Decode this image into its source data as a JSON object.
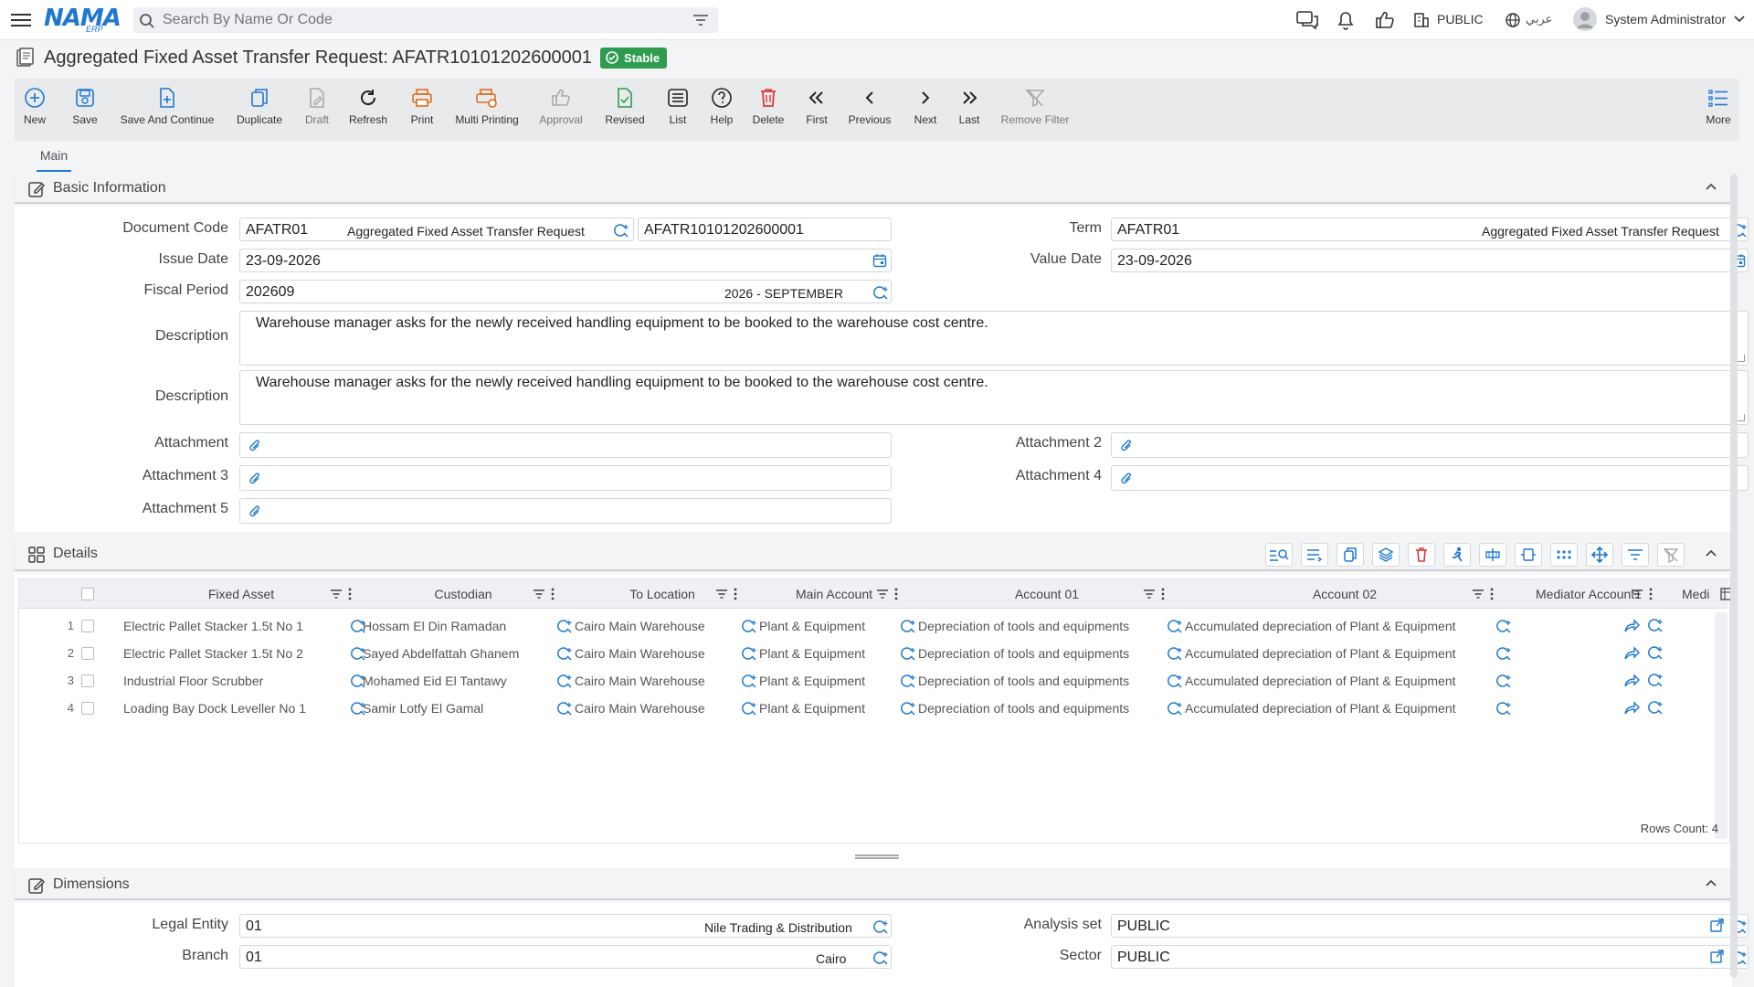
{
  "topbar": {
    "logo": "NAMA",
    "logo_sub": "ERP",
    "search_placeholder": "Search By Name Or Code",
    "entity": "PUBLIC",
    "language": "عربي",
    "user": "System Administrator"
  },
  "title": {
    "text": "Aggregated Fixed Asset Transfer Request: AFATR10101202600001",
    "status": "Stable"
  },
  "toolbar": {
    "new": "New",
    "save": "Save",
    "save_continue": "Save And Continue",
    "duplicate": "Duplicate",
    "draft": "Draft",
    "refresh": "Refresh",
    "print": "Print",
    "multi_printing": "Multi Printing",
    "approval": "Approval",
    "revised": "Revised",
    "list": "List",
    "help": "Help",
    "delete": "Delete",
    "first": "First",
    "previous": "Previous",
    "next": "Next",
    "last": "Last",
    "remove_filter": "Remove Filter",
    "more": "More"
  },
  "tabs": {
    "main": "Main"
  },
  "basic": {
    "title": "Basic Information",
    "document_code_label": "Document Code",
    "document_code": "AFATR01",
    "document_code_desc": "Aggregated Fixed Asset Transfer Request",
    "document_number": "AFATR10101202600001",
    "term_label": "Term",
    "term": "AFATR01",
    "term_desc": "Aggregated Fixed Asset Transfer Request",
    "issue_date_label": "Issue Date",
    "issue_date": "23-09-2026",
    "value_date_label": "Value Date",
    "value_date": "23-09-2026",
    "fiscal_period_label": "Fiscal Period",
    "fiscal_period": "202609",
    "fiscal_period_desc": "2026 - SEPTEMBER",
    "description_label": "Description",
    "description_1": "Warehouse manager asks for the newly received handling equipment to be booked to the warehouse cost centre.",
    "description_2": "Warehouse manager asks for the newly received handling equipment to be booked to the warehouse cost centre.",
    "attachment_1_label": "Attachment",
    "attachment_2_label": "Attachment 2",
    "attachment_3_label": "Attachment 3",
    "attachment_4_label": "Attachment 4",
    "attachment_5_label": "Attachment 5"
  },
  "details": {
    "title": "Details",
    "columns": [
      "Fixed Asset",
      "Custodian",
      "To Location",
      "Main Account",
      "Account 01",
      "Account 02",
      "Mediator Account1",
      "Medi"
    ],
    "rows": [
      {
        "num": "1",
        "fixed_asset": "Electric Pallet Stacker 1.5t No 1",
        "custodian": "Hossam El Din Ramadan",
        "to_location": "Cairo Main Warehouse",
        "main_account": "Plant & Equipment",
        "account_01": "Depreciation of tools and equipments",
        "account_02": "Accumulated depreciation of Plant & Equipment"
      },
      {
        "num": "2",
        "fixed_asset": "Electric Pallet Stacker 1.5t No 2",
        "custodian": "Sayed Abdelfattah Ghanem",
        "to_location": "Cairo Main Warehouse",
        "main_account": "Plant & Equipment",
        "account_01": "Depreciation of tools and equipments",
        "account_02": "Accumulated depreciation of Plant & Equipment"
      },
      {
        "num": "3",
        "fixed_asset": "Industrial Floor Scrubber",
        "custodian": "Mohamed Eid El Tantawy",
        "to_location": "Cairo Main Warehouse",
        "main_account": "Plant & Equipment",
        "account_01": "Depreciation of tools and equipments",
        "account_02": "Accumulated depreciation of Plant & Equipment"
      },
      {
        "num": "4",
        "fixed_asset": "Loading Bay Dock Leveller No 1",
        "custodian": "Samir Lotfy El Gamal",
        "to_location": "Cairo Main Warehouse",
        "main_account": "Plant & Equipment",
        "account_01": "Depreciation of tools and equipments",
        "account_02": "Accumulated depreciation of Plant & Equipment"
      }
    ],
    "rows_count": "Rows Count: 4"
  },
  "dimensions": {
    "title": "Dimensions",
    "legal_entity_label": "Legal Entity",
    "legal_entity": "01",
    "legal_entity_desc": "Nile Trading & Distribution",
    "analysis_set_label": "Analysis set",
    "analysis_set": "PUBLIC",
    "branch_label": "Branch",
    "branch": "01",
    "branch_desc": "Cairo",
    "sector_label": "Sector",
    "sector": "PUBLIC"
  },
  "colors": {
    "accent": "#1e78d2",
    "status": "#2e9c4f",
    "danger": "#d93a3a",
    "print": "#e06a1b"
  }
}
